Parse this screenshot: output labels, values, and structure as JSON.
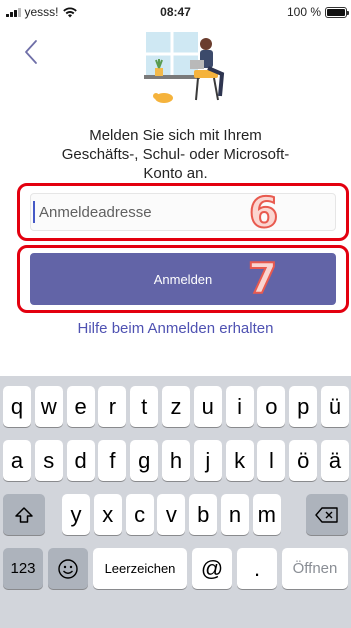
{
  "status_bar": {
    "carrier": "yesss!",
    "time": "08:47",
    "battery": "100 %",
    "battery_level": 1.0
  },
  "message": {
    "line1": "Melden Sie sich mit Ihrem",
    "line2": "Geschäfts-, Schul- oder Microsoft-",
    "line3": "Konto an."
  },
  "signin": {
    "placeholder": "Anmeldeadresse",
    "button_label": "Anmelden",
    "help_link": "Hilfe beim Anmelden erhalten"
  },
  "annotations": {
    "field_number": "6",
    "button_number": "7",
    "highlight_color": "#e3000f"
  },
  "keyboard": {
    "row1": [
      "q",
      "w",
      "e",
      "r",
      "t",
      "z",
      "u",
      "i",
      "o",
      "p",
      "ü"
    ],
    "row2": [
      "a",
      "s",
      "d",
      "f",
      "g",
      "h",
      "j",
      "k",
      "l",
      "ö",
      "ä"
    ],
    "row3": [
      "y",
      "x",
      "c",
      "v",
      "b",
      "n",
      "m"
    ],
    "numbers_key": "123",
    "space_key": "Leerzeichen",
    "at_key": "@",
    "dot_key": ".",
    "return_key": "Öffnen"
  },
  "colors": {
    "accent": "#6264a7",
    "link": "#4f52b2"
  }
}
